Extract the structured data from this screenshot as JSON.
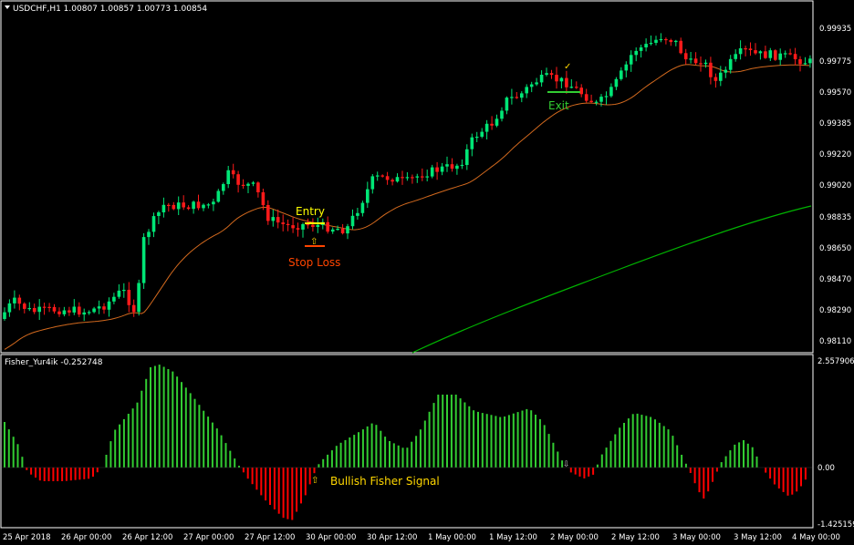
{
  "window": {
    "symbol_header": "USDCHF,H1  1.00807 1.00857 1.00773 1.00854",
    "menu_icon": "triangle-down-icon"
  },
  "price_axis": {
    "labels": [
      "0.99935",
      "0.99775",
      "0.99570",
      "0.99385",
      "0.99220",
      "0.99020",
      "0.98835",
      "0.98650",
      "0.98470",
      "0.98290",
      "0.98110"
    ]
  },
  "annotations": {
    "entry": "Entry",
    "stop_loss": "Stop Loss",
    "exit": "Exit",
    "bullish_signal": "Bullish Fisher Signal"
  },
  "indicator": {
    "name": "Fisher_Yur4ik -0.252748",
    "axis_labels": [
      "2.557906",
      "0.00",
      "-1.425159"
    ]
  },
  "time_axis": {
    "labels": [
      "25 Apr 2018",
      "26 Apr 00:00",
      "26 Apr 12:00",
      "27 Apr 00:00",
      "27 Apr 12:00",
      "30 Apr 00:00",
      "30 Apr 12:00",
      "1 May 00:00",
      "1 May 12:00",
      "2 May 00:00",
      "2 May 12:00",
      "3 May 00:00",
      "3 May 12:00",
      "4 May 00:00"
    ]
  },
  "colors": {
    "background": "#000000",
    "bull_candle": "#00e676",
    "bear_candle": "#ff1a1a",
    "ma_fast": "#d2691e",
    "ma_slow": "#00b400",
    "fisher_pos": "#32cd32",
    "fisher_neg": "#ff0000",
    "entry_color": "#ffff00",
    "stop_color": "#ff4500",
    "exit_color": "#32cd32",
    "signal_color": "#ffd700",
    "axis_text": "#ffffff"
  }
}
